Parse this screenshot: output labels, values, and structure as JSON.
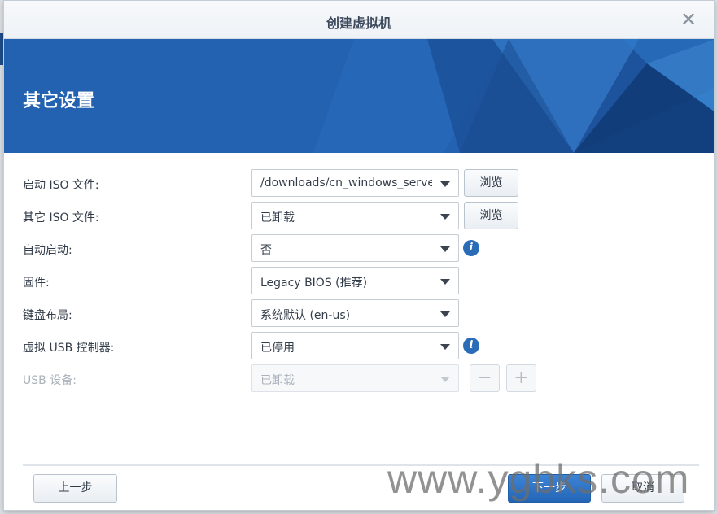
{
  "dialog": {
    "title": "创建虚拟机",
    "close_glyph": "✕"
  },
  "banner": {
    "heading": "其它设置"
  },
  "form": {
    "rows": [
      {
        "label": "启动 ISO 文件:",
        "value": "/downloads/cn_windows_server",
        "button": "浏览"
      },
      {
        "label": "其它 ISO 文件:",
        "value": "已卸载",
        "button": "浏览"
      },
      {
        "label": "自动启动:",
        "value": "否",
        "info": "i"
      },
      {
        "label": "固件:",
        "value": "Legacy BIOS (推荐)"
      },
      {
        "label": "键盘布局:",
        "value": "系统默认 (en-us)"
      },
      {
        "label": "虚拟 USB 控制器:",
        "value": "已停用",
        "info": "i"
      },
      {
        "label": "USB 设备:",
        "value": "已卸载",
        "disabled": true,
        "minus": "−",
        "plus": "+"
      }
    ]
  },
  "footer": {
    "prev_label": "上一步",
    "next_label": "下一步",
    "cancel_label": "取消"
  },
  "watermark": "www.ygbks.com",
  "colors": {
    "banner": "#2362b0",
    "primary_button": "#2b6cb8",
    "info_icon": "#2b6cb8"
  }
}
